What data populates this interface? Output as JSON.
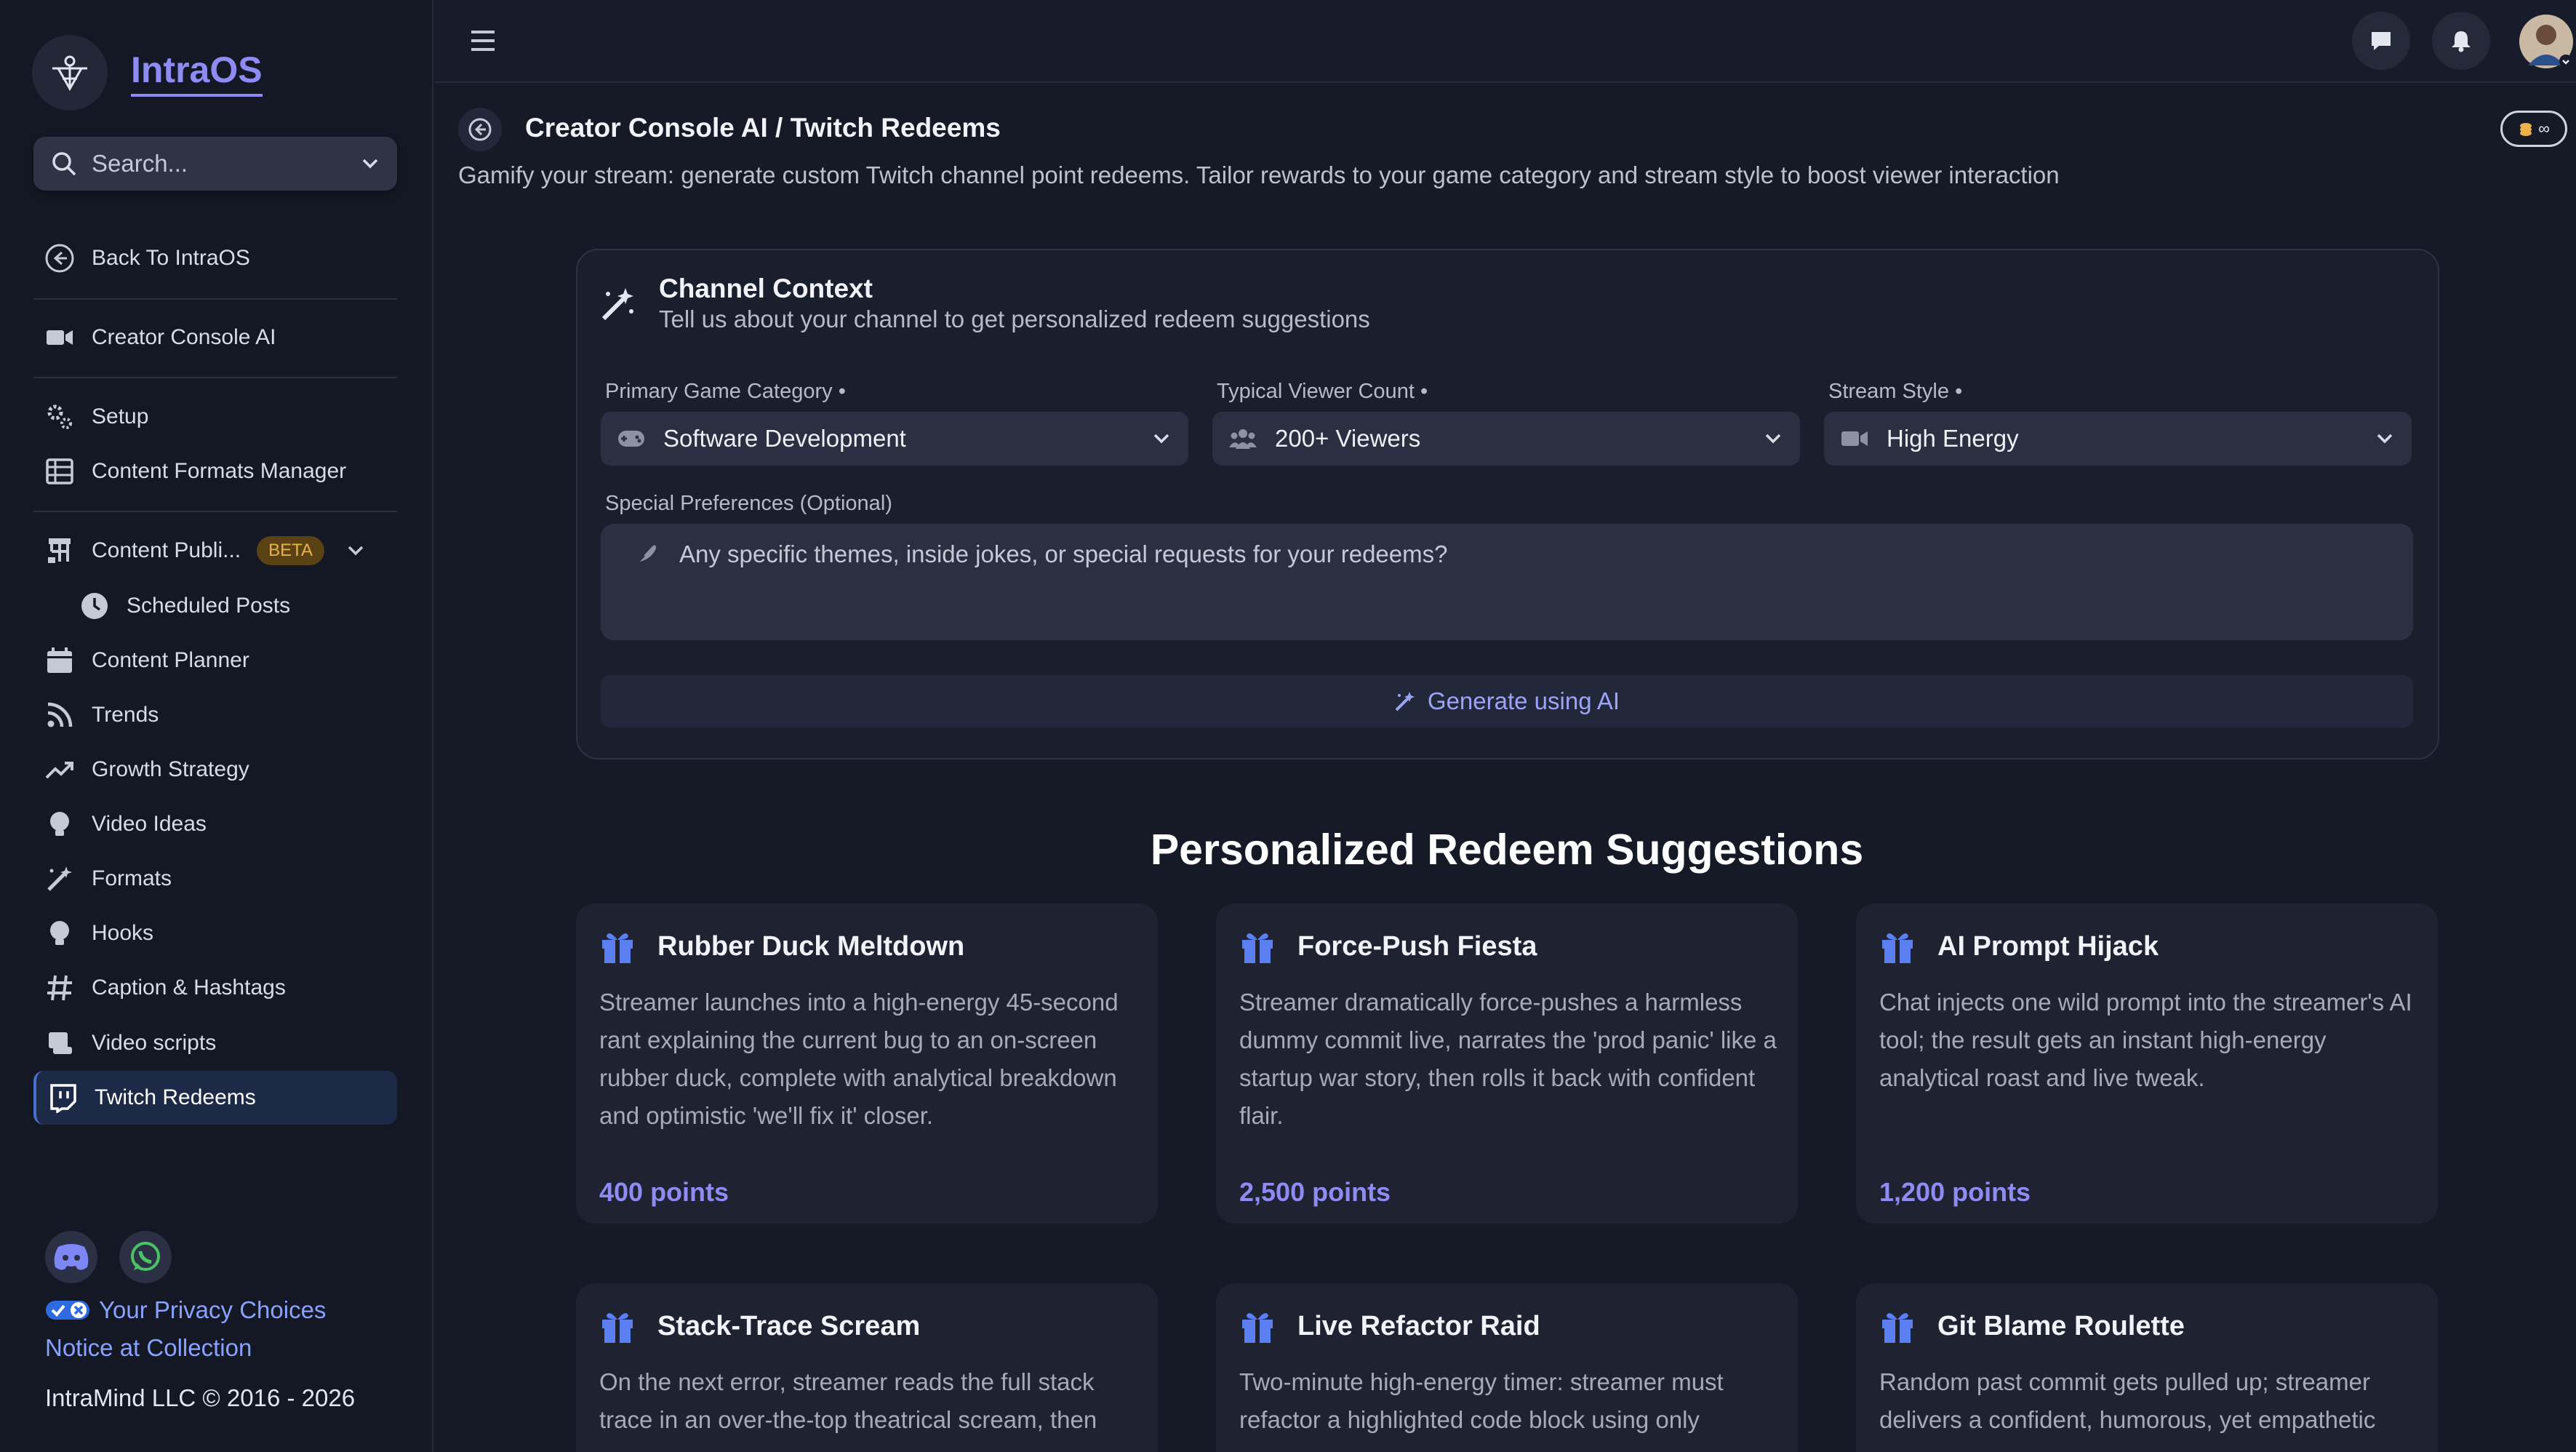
{
  "app": {
    "name": "IntraOS"
  },
  "search": {
    "placeholder": "Search..."
  },
  "sidebar": {
    "items": [
      {
        "label": "Back To IntraOS"
      },
      {
        "label": "Creator Console AI"
      },
      {
        "label": "Setup"
      },
      {
        "label": "Content Formats Manager"
      },
      {
        "label": "Content Publi...",
        "badge": "BETA"
      },
      {
        "label": "Scheduled Posts"
      },
      {
        "label": "Content Planner"
      },
      {
        "label": "Trends"
      },
      {
        "label": "Growth Strategy"
      },
      {
        "label": "Video Ideas"
      },
      {
        "label": "Formats"
      },
      {
        "label": "Hooks"
      },
      {
        "label": "Caption & Hashtags"
      },
      {
        "label": "Video scripts"
      },
      {
        "label": "Twitch Redeems"
      }
    ],
    "footer": {
      "privacy": "Your Privacy Choices",
      "notice": "Notice at Collection",
      "copyright": "IntraMind LLC © 2016 - 2026"
    }
  },
  "header": {
    "title": "Creator Console AI / Twitch Redeems",
    "subtitle": "Gamify your stream: generate custom Twitch channel point redeems. Tailor rewards to your game category and stream style to boost viewer interaction",
    "credits": "∞"
  },
  "context": {
    "title": "Channel Context",
    "subtitle": "Tell us about your channel to get personalized redeem suggestions",
    "fields": [
      {
        "label": "Primary Game Category",
        "value": "Software Development"
      },
      {
        "label": "Typical Viewer Count",
        "value": "200+ Viewers"
      },
      {
        "label": "Stream Style",
        "value": "High Energy"
      }
    ],
    "required_mark": "•",
    "special_label": "Special Preferences (Optional)",
    "special_placeholder": "Any specific themes, inside jokes, or special requests for your redeems?",
    "generate_label": "Generate using AI"
  },
  "suggestions": {
    "title": "Personalized Redeem Suggestions",
    "cards": [
      {
        "title": "Rubber Duck Meltdown",
        "desc": "Streamer launches into a high-energy 45-second rant explaining the current bug to an on-screen rubber duck, complete with analytical breakdown and optimistic 'we'll fix it' closer.",
        "points": "400 points"
      },
      {
        "title": "Force-Push Fiesta",
        "desc": "Streamer dramatically force-pushes a harmless dummy commit live, narrates the 'prod panic' like a startup war story, then rolls it back with confident flair.",
        "points": "2,500 points"
      },
      {
        "title": "AI Prompt Hijack",
        "desc": "Chat injects one wild prompt into the streamer's AI tool; the result gets an instant high-energy analytical roast and live tweak.",
        "points": "1,200 points"
      },
      {
        "title": "Stack-Trace Scream",
        "desc": "On the next error, streamer reads the full stack trace in an over-the-top theatrical scream, then",
        "points": ""
      },
      {
        "title": "Live Refactor Raid",
        "desc": "Two-minute high-energy timer: streamer must refactor a highlighted code block using only",
        "points": ""
      },
      {
        "title": "Git Blame Roulette",
        "desc": "Random past commit gets pulled up; streamer delivers a confident, humorous, yet empathetic",
        "points": ""
      }
    ]
  },
  "colors": {
    "accent": "#8e8cf4",
    "active_bg": "#1d2a47",
    "gift": "#5b7ff0"
  }
}
